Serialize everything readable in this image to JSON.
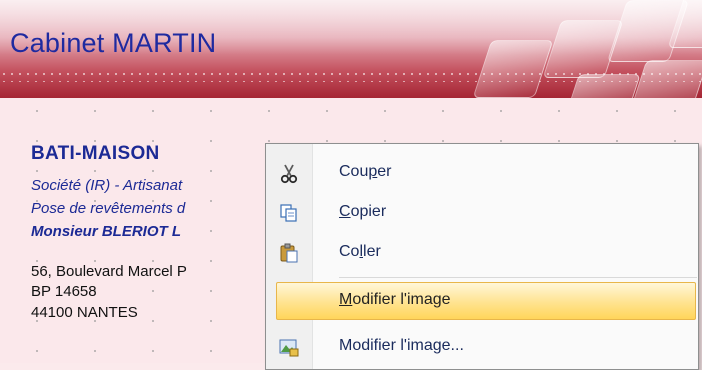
{
  "header": {
    "title": "Cabinet MARTIN"
  },
  "company": {
    "name": "BATI-MAISON",
    "line1": "Société (IR) - Artisanat",
    "line2": "Pose de revêtements d",
    "line3": "Monsieur BLERIOT L",
    "address1": "56, Boulevard Marcel P",
    "address2": "BP 14658",
    "address3": "44100 NANTES"
  },
  "context_menu": {
    "items": [
      {
        "label_pre": "Cou",
        "label_u": "p",
        "label_post": "er",
        "icon": "scissors-icon"
      },
      {
        "label_pre": "",
        "label_u": "C",
        "label_post": "opier",
        "icon": "copy-icon"
      },
      {
        "label_pre": "Co",
        "label_u": "l",
        "label_post": "ler",
        "icon": "paste-icon"
      },
      {
        "label_pre": "",
        "label_u": "M",
        "label_post": "odifier l'image",
        "highlighted": true
      },
      {
        "label_pre": "Modifier l'ima",
        "label_u": "g",
        "label_post": "e...",
        "icon": "edit-image-icon"
      }
    ]
  },
  "colors": {
    "banner": "#c4525f",
    "title_text": "#1e2aa0",
    "menu_highlight": "#ffe38f"
  }
}
